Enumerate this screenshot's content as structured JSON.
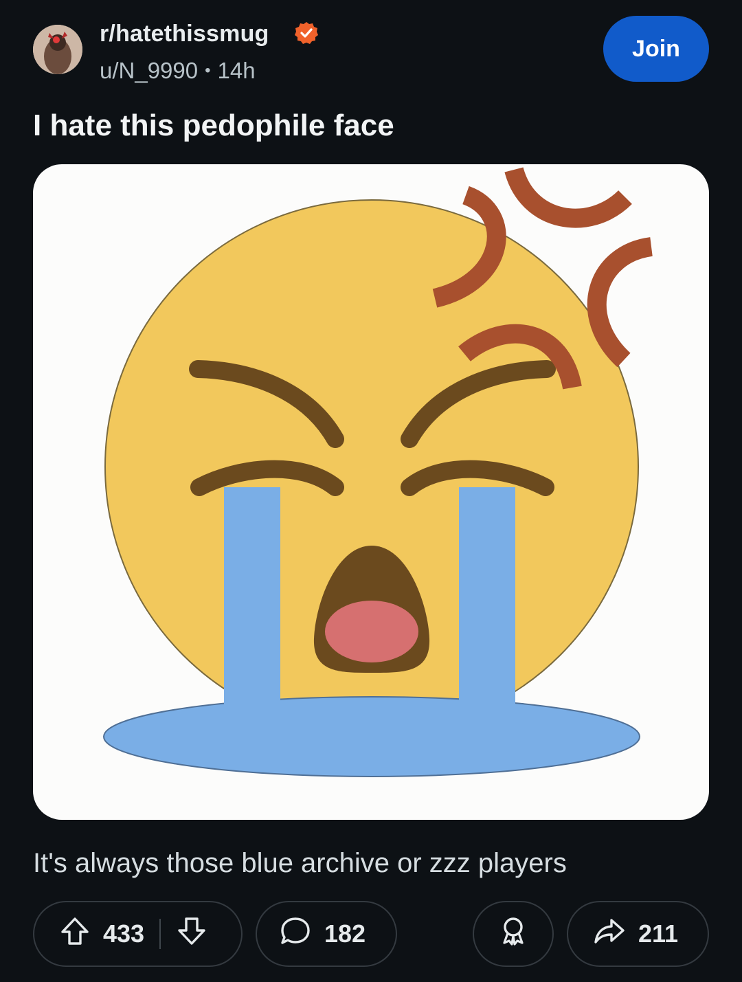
{
  "post": {
    "subreddit": "r/hatethissmug",
    "author": "u/N_9990",
    "separator": "•",
    "time": "14h",
    "join_label": "Join",
    "title": "I hate this pedophile face",
    "body": "It's always those blue archive or zzz players"
  },
  "actions": {
    "upvotes": "433",
    "comments": "182",
    "shares": "211"
  },
  "colors": {
    "background": "#0d1115",
    "join_button": "#115bca",
    "verified_badge": "#f0622b",
    "emoji_face": "#f2c85c",
    "emoji_tears": "#7aaee6",
    "emoji_features": "#6b4a1e",
    "anger_marks": "#a8502e"
  },
  "icons": [
    "verified-icon",
    "upvote-icon",
    "downvote-icon",
    "comment-icon",
    "award-icon",
    "share-icon"
  ]
}
